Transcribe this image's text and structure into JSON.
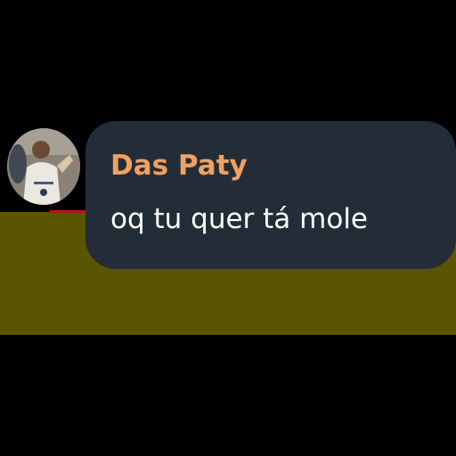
{
  "message": {
    "sender_name": "Das Paty",
    "text": "oq tu quer tá mole",
    "avatar_icon": "user-photo-icon"
  },
  "colors": {
    "background": "#000000",
    "band": "#5a5500",
    "bubble": "#232d37",
    "sender": "#f0a060",
    "text": "#ffffff",
    "accent_line": "#b01d12"
  }
}
